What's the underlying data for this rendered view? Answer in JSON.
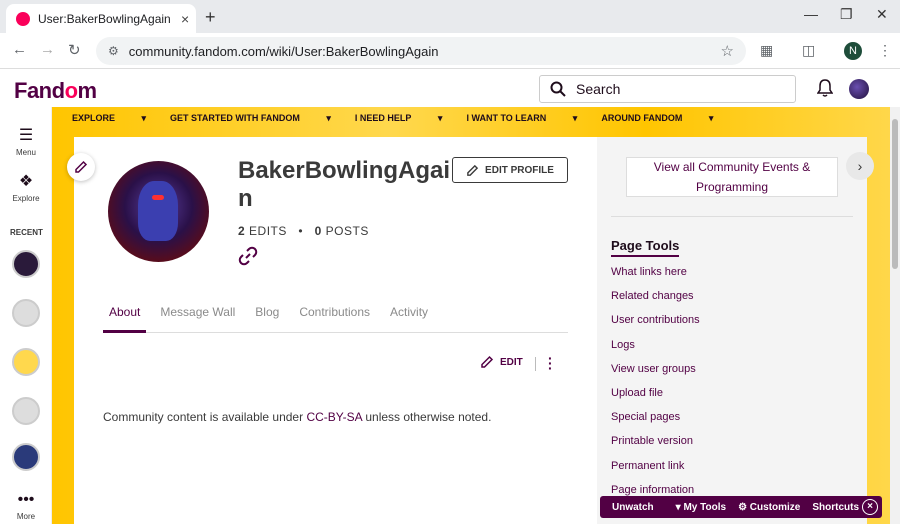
{
  "browser": {
    "tab_title": "User:BakerBowlingAgain | Com",
    "url": "community.fandom.com/wiki/User:BakerBowlingAgain",
    "profile_initial": "N",
    "new_tab_glyph": "+",
    "tab_close_glyph": "×"
  },
  "header": {
    "logo_text_1": "Fand",
    "logo_text_2": "o",
    "logo_text_3": "m",
    "search_placeholder": "Search"
  },
  "left_rail": {
    "menu_label": "Menu",
    "explore_label": "Explore",
    "recent_label": "RECENT",
    "more_label": "More"
  },
  "community_nav": {
    "items": [
      "EXPLORE",
      "GET STARTED WITH FANDOM",
      "I NEED HELP",
      "I WANT TO LEARN",
      "AROUND FANDOM"
    ]
  },
  "profile": {
    "username": "BakerBowlingAgain",
    "edit_profile_label": "EDIT PROFILE",
    "edits_count": "2",
    "edits_label": "EDITS",
    "posts_count": "0",
    "posts_label": "POSTS",
    "separator": "•"
  },
  "tabs": [
    {
      "label": "About",
      "active": true
    },
    {
      "label": "Message Wall",
      "active": false
    },
    {
      "label": "Blog",
      "active": false
    },
    {
      "label": "Contributions",
      "active": false
    },
    {
      "label": "Activity",
      "active": false
    }
  ],
  "content": {
    "edit_label": "EDIT",
    "license_prefix": "Community content is available under ",
    "license_link": "CC-BY-SA",
    "license_suffix": " unless otherwise noted."
  },
  "right_rail": {
    "events_button": "View all Community Events & Programming",
    "page_tools_title": "Page Tools",
    "page_tools": [
      "What links here",
      "Related changes",
      "User contributions",
      "Logs",
      "View user groups",
      "Upload file",
      "Special pages",
      "Printable version",
      "Permanent link",
      "Page information"
    ]
  },
  "bottom_bar": {
    "unwatch": "Unwatch",
    "my_tools": "▾ My Tools",
    "customize": "⚙ Customize",
    "shortcuts": "Shortcuts",
    "close_glyph": "×"
  },
  "colors": {
    "brand_dark": "#520044",
    "brand_pink": "#fa005a",
    "banner_yellow": "#ffc500"
  }
}
